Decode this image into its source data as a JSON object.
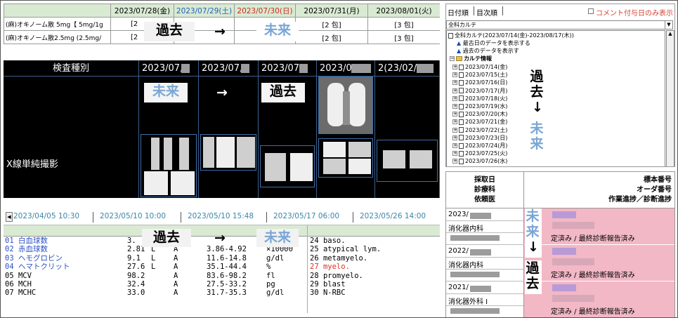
{
  "overlay": {
    "past": "過去",
    "future": "未来",
    "arrow_right": "→",
    "arrow_down": "↓"
  },
  "medication": {
    "dates": [
      {
        "label": "2023/07/28(金)",
        "kind": "weekday"
      },
      {
        "label": "2023/07/29(土)",
        "kind": "saturday"
      },
      {
        "label": "2023/07/30(日)",
        "kind": "sunday"
      },
      {
        "label": "2023/07/31(月)",
        "kind": "weekday"
      },
      {
        "label": "2023/08/01(火)",
        "kind": "weekday"
      }
    ],
    "rows": [
      {
        "name": "(麻)オキノーム散 5mg【 5mg/1g",
        "cells": [
          "[2",
          "",
          "",
          "[2 包]",
          "[3 包]"
        ]
      },
      {
        "name": "(麻)オキノーム散2.5mg (2.5mg/",
        "cells": [
          "[2",
          "",
          "",
          "[2 包]",
          "[3 包]"
        ]
      }
    ]
  },
  "xray": {
    "header_label": "検査種別",
    "dates": [
      "2023/07,",
      "2023/07,",
      "2023/07,",
      "2023/06",
      "2(23/02/"
    ],
    "kind": "X線単純撮影"
  },
  "lab": {
    "tabs": [
      "2023/04/05 10:30",
      "2023/05/10 10:00",
      "2023/05/10 15:48",
      "2023/05/17 06:00",
      "2023/05/26 14:00"
    ],
    "rows": [
      {
        "name": "01 白血球数",
        "value": "3.",
        "flag": "",
        "grade": "A",
        "range": "",
        "unit": "/",
        "right": "24  baso.",
        "color": "blue",
        "rcolor": ""
      },
      {
        "name": "02 赤血球数",
        "value": "2.81",
        "flag": "L",
        "grade": "A",
        "range": "3.86-4.92",
        "unit": "×10000",
        "right": "25  atypical lym.",
        "color": "blue",
        "rcolor": ""
      },
      {
        "name": "03 ヘモグロビン",
        "value": "9.1",
        "flag": "L",
        "grade": "A",
        "range": "11.6-14.8",
        "unit": "g/dl",
        "right": "26  metamyelo.",
        "color": "blue",
        "rcolor": ""
      },
      {
        "name": "04 ヘマトクリット",
        "value": "27.6",
        "flag": "L",
        "grade": "A",
        "range": "35.1-44.4",
        "unit": "%",
        "right": "27  myelo.",
        "color": "blue",
        "rcolor": "red"
      },
      {
        "name": "05 MCV",
        "value": "98.2",
        "flag": "",
        "grade": "A",
        "range": "83.6-98.2",
        "unit": "fl",
        "right": "28  promyelo.",
        "color": "",
        "rcolor": ""
      },
      {
        "name": "06 MCH",
        "value": "32.4",
        "flag": "",
        "grade": "A",
        "range": "27.5-33.2",
        "unit": "pg",
        "right": "29  blast",
        "color": "",
        "rcolor": ""
      },
      {
        "name": "07 MCHC",
        "value": "33.0",
        "flag": "",
        "grade": "A",
        "range": "31.7-35.3",
        "unit": "g/dl",
        "right": "30  N-RBC",
        "color": "",
        "rcolor": ""
      }
    ]
  },
  "tree": {
    "tabs": [
      "日付順",
      "目次順"
    ],
    "comment_only_label": "コメント付与日のみ表示",
    "combo_value": "全科カルテ",
    "root": "全科カルテ(2023/07/14(金)-2023/08/17(木))",
    "latest": "最古日のデータを表示する",
    "past": "過去のデータを表示す",
    "folder": "カルテ情報",
    "dates": [
      "2023/07/14(金)",
      "2023/07/15(土)",
      "2023/07/16(日)",
      "2023/07/17(月)",
      "2023/07/18(火)",
      "2023/07/19(水)",
      "2023/07/20(木)",
      "2023/07/21(金)",
      "2023/07/22(土)",
      "2023/07/23(日)",
      "2023/07/24(月)",
      "2023/07/25(火)",
      "2023/07/26(水)"
    ]
  },
  "specimen": {
    "left_header": [
      "採取日",
      "診療科",
      "依頼医"
    ],
    "right_header": [
      "標本番号",
      "オーダ番号",
      "作業進捗／診断進捗"
    ],
    "groups": [
      {
        "date": "2023/",
        "dept": "消化器内科",
        "status": "定済み / 最終診断報告済み"
      },
      {
        "date": "2022/",
        "dept": "消化器内科",
        "status": "定済み / 最終診断報告済み"
      },
      {
        "date": "2021/",
        "dept": "消化器外科 I",
        "status": "定済み / 最終診断報告済み"
      }
    ]
  }
}
